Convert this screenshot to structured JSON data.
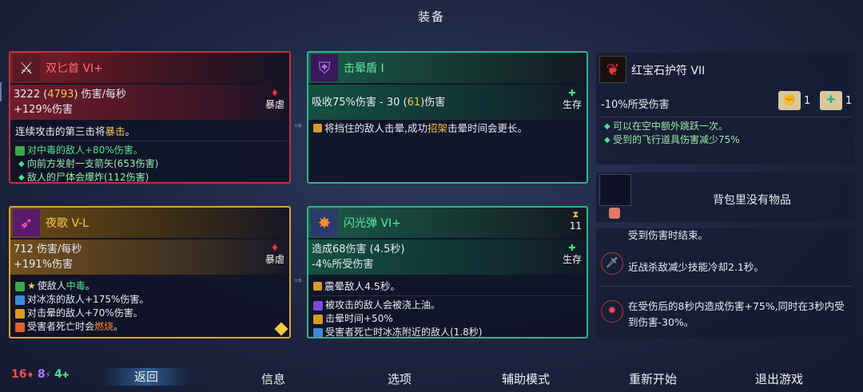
{
  "title": "装备",
  "cards": {
    "dagger": {
      "name": "双匕首 VI+",
      "stat1_a": "3222 (",
      "stat1_hl": "4793",
      "stat1_b": ") 伤害/每秒",
      "stat2": "+129%伤害",
      "tag": "暴虐",
      "desc_a": "连续攻击的第三击将",
      "desc_hl": "暴击",
      "desc_b": "。",
      "lines": [
        "对中毒的敌人+80%伤害。",
        "向前方发射一支箭矢(653伤害)",
        "敌人的尸体会爆炸(112伤害)"
      ]
    },
    "shield": {
      "name": "击晕盾 I",
      "stat1_a": "吸收75%伤害 - 30 (",
      "stat1_hl": "61",
      "stat1_b": ")伤害",
      "tag": "生存",
      "desc_a": "将挡住的敌人击晕,成功",
      "desc_hl": "招架",
      "desc_b": "击晕时间会更长。"
    },
    "amulet": {
      "name": "红宝石护符 VII",
      "stat1": "-10%所受伤害",
      "scroll1": "1",
      "scroll2": "1",
      "lines": [
        "可以在空中额外跳跃一次。",
        "受到的飞行道具伤害减少75%"
      ]
    },
    "bow": {
      "name": "夜歌 V-L",
      "stat1": "712 伤害/每秒",
      "stat2": "+191%伤害",
      "tag": "暴虐",
      "line1_a": "使敌人",
      "line1_hl": "中毒",
      "line1_b": "。",
      "line2": "对冰冻的敌人+175%伤害。",
      "line3": "对击晕的敌人+70%伤害。",
      "line4_a": "受害者死亡时会",
      "line4_hl": "燃烧",
      "line4_b": "。"
    },
    "flash": {
      "name": "闪光弹 VI+",
      "stat1": "造成68伤害 (4.5秒)",
      "stat2": "-4%所受伤害",
      "tag": "生存",
      "timer": "11",
      "desc": "震晕敌人4.5秒。",
      "line1": "被攻击的敌人会被浇上油。",
      "line2": "击晕时间+50%",
      "line3": "受害者死亡时冰冻附近的敌人(1.8秒)"
    },
    "backpack": {
      "text": "背包里没有物品"
    },
    "mutations": {
      "partial": "受到伤害时结束。",
      "m1": "近战杀敌减少技能冷却2.1秒。",
      "m2": "在受伤后的8秒内造成伤害+75%,同时在3秒内受到伤害-30%。"
    }
  },
  "scrolls": {
    "brutality": "16",
    "tactics": "8",
    "survival": "4"
  },
  "menu": [
    "返回",
    "信息",
    "选项",
    "辅助模式",
    "重新开始",
    "退出游戏"
  ],
  "colors": {
    "brutality": "#c0303e",
    "survival": "#2bb58a",
    "tactics": "#9b5de5",
    "legendary": "#d7a72e"
  }
}
